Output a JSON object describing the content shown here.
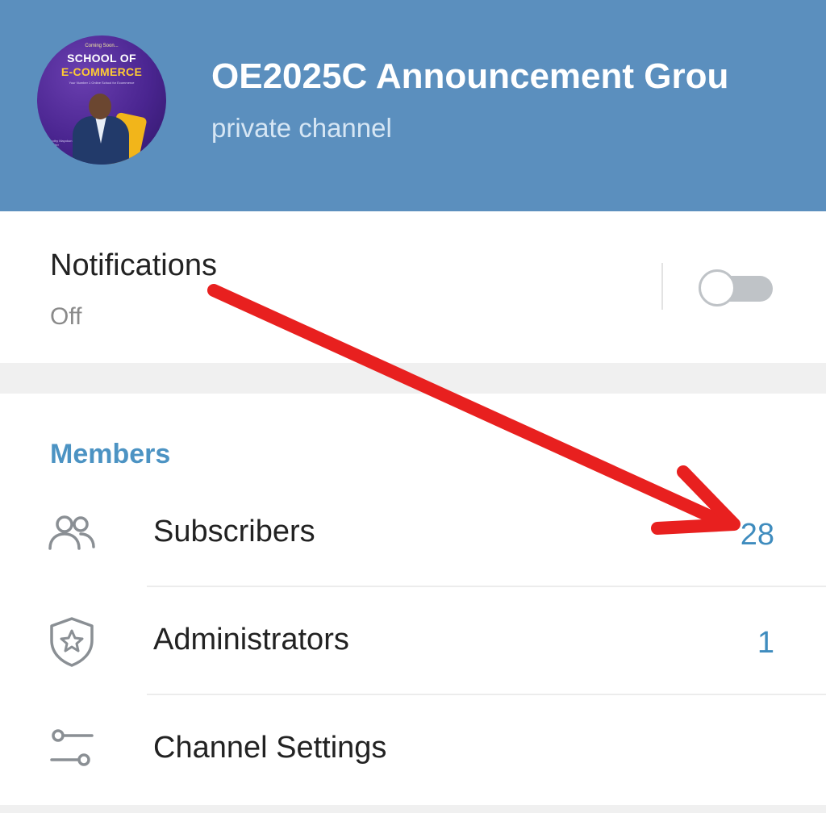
{
  "header": {
    "title": "OE2025C Announcement Grou",
    "subtitle": "private channel",
    "background_color": "#5b8fbe",
    "avatar": {
      "coming_soon": "Coming Soon...",
      "line1": "SCHOOL OF",
      "line2": "E-COMMERCE",
      "tagline": "Your Number 1 Online School for Ecommerce",
      "caption_name": "Timothy Mayokun",
      "caption_role": "Founder"
    }
  },
  "notifications": {
    "label": "Notifications",
    "status": "Off",
    "toggle_on": false
  },
  "members": {
    "section_title": "Members",
    "accent_color": "#4c93c3",
    "rows": [
      {
        "label": "Subscribers",
        "value": "28",
        "icon": "people-icon"
      },
      {
        "label": "Administrators",
        "value": "1",
        "icon": "shield-star-icon"
      },
      {
        "label": "Channel Settings",
        "value": "",
        "icon": "settings-sliders-icon"
      }
    ]
  },
  "annotation": {
    "color": "#e8201f",
    "icon": "red-arrow-annotation"
  }
}
